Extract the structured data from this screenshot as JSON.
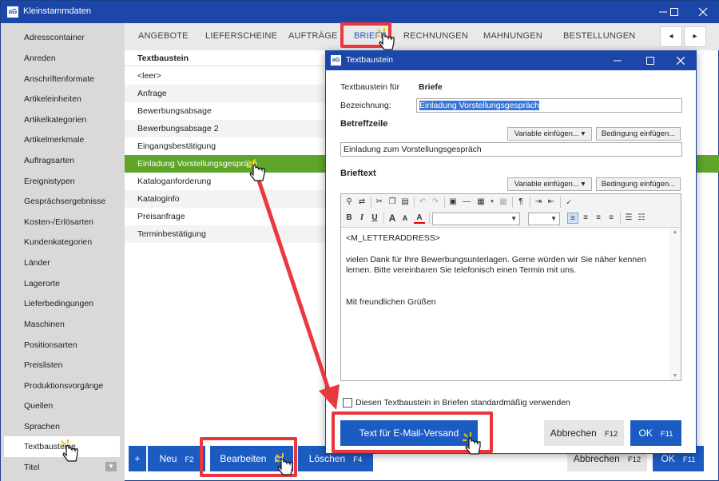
{
  "window": {
    "title": "Kleinstammdaten",
    "app_icon": "aG"
  },
  "sidebar": {
    "items": [
      "Adresscontainer",
      "Anreden",
      "Anschriftenformate",
      "Artikeleinheiten",
      "Artikelkategorien",
      "Artikelmerkmale",
      "Auftragsarten",
      "Ereignistypen",
      "Gesprächsergebnisse",
      "Kosten-/Erlösarten",
      "Kundenkategorien",
      "Länder",
      "Lagerorte",
      "Lieferbedingungen",
      "Maschinen",
      "Positionsarten",
      "Preislisten",
      "Produktionsvorgänge",
      "Quellen",
      "Sprachen",
      "Textbausteine",
      "Titel"
    ],
    "active_index": 20
  },
  "tabs": {
    "items": [
      "ANGEBOTE",
      "LIEFERSCHEINE",
      "AUFTRÄGE",
      "BRIEFE",
      "RECHNUNGEN",
      "MAHNUNGEN",
      "BESTELLUNGEN"
    ],
    "active_index": 3,
    "prev": "◂",
    "next": "▸"
  },
  "list": {
    "header": "Textbaustein",
    "rows": [
      "<leer>",
      "Anfrage",
      "Bewerbungsabsage",
      "Bewerbungsabsage 2",
      "Eingangsbestätigung",
      "Einladung Vorstellungsgespräch",
      "Kataloganforderung",
      "Kataloginfo",
      "Preisanfrage",
      "Terminbestätigung"
    ],
    "selected_index": 5
  },
  "bottom": {
    "plus": "+",
    "new_label": "Neu",
    "new_key": "F2",
    "edit_label": "Bearbeiten",
    "edit_key": "F3",
    "delete_label": "Löschen",
    "delete_key": "F4",
    "cancel_label": "Abbrechen",
    "cancel_key": "F12",
    "ok_label": "OK",
    "ok_key": "F11"
  },
  "dialog": {
    "title": "Textbaustein",
    "for_label": "Textbaustein für",
    "for_value": "Briefe",
    "name_label": "Bezeichnung:",
    "name_value": "Einladung Vorstellungsgespräch",
    "subject_heading": "Betreffzeile",
    "subject_value": "Einladung zum Vorstellungsgespräch",
    "variable_btn": "Variable einfügen...",
    "condition_btn": "Bedingung einfügen...",
    "body_heading": "Brieftext",
    "body_lines": [
      "<M_LETTERADDRESS>",
      "",
      "vielen Dank für Ihre Bewerbungsunterlagen. Gerne würden wir Sie näher kennen",
      "lernen. Bitte vereinbaren Sie telefonisch einen Termin mit uns.",
      "",
      "",
      "Mit freundlichen Grüßen"
    ],
    "default_checkbox": "Diesen Textbaustein in Briefen standardmäßig verwenden",
    "email_btn": "Text für E-Mail-Versand",
    "cancel_label": "Abbrechen",
    "cancel_key": "F12",
    "ok_label": "OK",
    "ok_key": "F11"
  },
  "colors": {
    "titlebar": "#1c46a8",
    "accent_blue": "#1c5bc2",
    "selection_green": "#5ea52a",
    "annotation_red": "#e8383d"
  }
}
